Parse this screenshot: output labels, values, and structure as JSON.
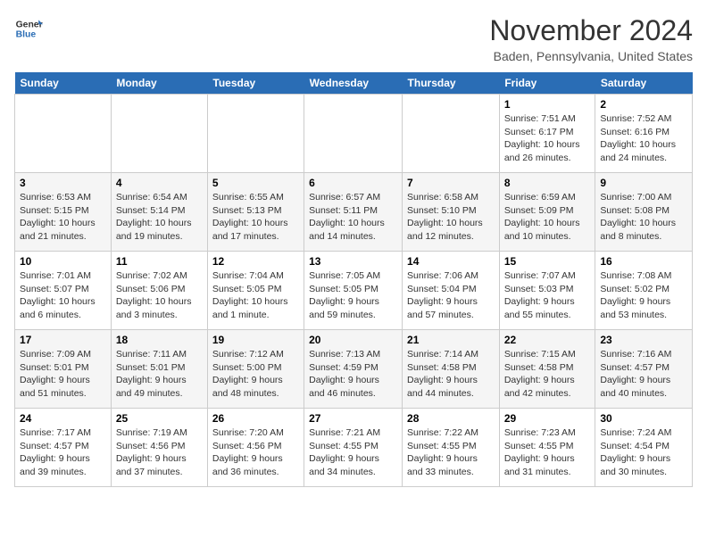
{
  "header": {
    "logo_line1": "General",
    "logo_line2": "Blue",
    "month_title": "November 2024",
    "location": "Baden, Pennsylvania, United States"
  },
  "weekdays": [
    "Sunday",
    "Monday",
    "Tuesday",
    "Wednesday",
    "Thursday",
    "Friday",
    "Saturday"
  ],
  "weeks": [
    [
      {
        "day": "",
        "info": ""
      },
      {
        "day": "",
        "info": ""
      },
      {
        "day": "",
        "info": ""
      },
      {
        "day": "",
        "info": ""
      },
      {
        "day": "",
        "info": ""
      },
      {
        "day": "1",
        "info": "Sunrise: 7:51 AM\nSunset: 6:17 PM\nDaylight: 10 hours\nand 26 minutes."
      },
      {
        "day": "2",
        "info": "Sunrise: 7:52 AM\nSunset: 6:16 PM\nDaylight: 10 hours\nand 24 minutes."
      }
    ],
    [
      {
        "day": "3",
        "info": "Sunrise: 6:53 AM\nSunset: 5:15 PM\nDaylight: 10 hours\nand 21 minutes."
      },
      {
        "day": "4",
        "info": "Sunrise: 6:54 AM\nSunset: 5:14 PM\nDaylight: 10 hours\nand 19 minutes."
      },
      {
        "day": "5",
        "info": "Sunrise: 6:55 AM\nSunset: 5:13 PM\nDaylight: 10 hours\nand 17 minutes."
      },
      {
        "day": "6",
        "info": "Sunrise: 6:57 AM\nSunset: 5:11 PM\nDaylight: 10 hours\nand 14 minutes."
      },
      {
        "day": "7",
        "info": "Sunrise: 6:58 AM\nSunset: 5:10 PM\nDaylight: 10 hours\nand 12 minutes."
      },
      {
        "day": "8",
        "info": "Sunrise: 6:59 AM\nSunset: 5:09 PM\nDaylight: 10 hours\nand 10 minutes."
      },
      {
        "day": "9",
        "info": "Sunrise: 7:00 AM\nSunset: 5:08 PM\nDaylight: 10 hours\nand 8 minutes."
      }
    ],
    [
      {
        "day": "10",
        "info": "Sunrise: 7:01 AM\nSunset: 5:07 PM\nDaylight: 10 hours\nand 6 minutes."
      },
      {
        "day": "11",
        "info": "Sunrise: 7:02 AM\nSunset: 5:06 PM\nDaylight: 10 hours\nand 3 minutes."
      },
      {
        "day": "12",
        "info": "Sunrise: 7:04 AM\nSunset: 5:05 PM\nDaylight: 10 hours\nand 1 minute."
      },
      {
        "day": "13",
        "info": "Sunrise: 7:05 AM\nSunset: 5:05 PM\nDaylight: 9 hours\nand 59 minutes."
      },
      {
        "day": "14",
        "info": "Sunrise: 7:06 AM\nSunset: 5:04 PM\nDaylight: 9 hours\nand 57 minutes."
      },
      {
        "day": "15",
        "info": "Sunrise: 7:07 AM\nSunset: 5:03 PM\nDaylight: 9 hours\nand 55 minutes."
      },
      {
        "day": "16",
        "info": "Sunrise: 7:08 AM\nSunset: 5:02 PM\nDaylight: 9 hours\nand 53 minutes."
      }
    ],
    [
      {
        "day": "17",
        "info": "Sunrise: 7:09 AM\nSunset: 5:01 PM\nDaylight: 9 hours\nand 51 minutes."
      },
      {
        "day": "18",
        "info": "Sunrise: 7:11 AM\nSunset: 5:01 PM\nDaylight: 9 hours\nand 49 minutes."
      },
      {
        "day": "19",
        "info": "Sunrise: 7:12 AM\nSunset: 5:00 PM\nDaylight: 9 hours\nand 48 minutes."
      },
      {
        "day": "20",
        "info": "Sunrise: 7:13 AM\nSunset: 4:59 PM\nDaylight: 9 hours\nand 46 minutes."
      },
      {
        "day": "21",
        "info": "Sunrise: 7:14 AM\nSunset: 4:58 PM\nDaylight: 9 hours\nand 44 minutes."
      },
      {
        "day": "22",
        "info": "Sunrise: 7:15 AM\nSunset: 4:58 PM\nDaylight: 9 hours\nand 42 minutes."
      },
      {
        "day": "23",
        "info": "Sunrise: 7:16 AM\nSunset: 4:57 PM\nDaylight: 9 hours\nand 40 minutes."
      }
    ],
    [
      {
        "day": "24",
        "info": "Sunrise: 7:17 AM\nSunset: 4:57 PM\nDaylight: 9 hours\nand 39 minutes."
      },
      {
        "day": "25",
        "info": "Sunrise: 7:19 AM\nSunset: 4:56 PM\nDaylight: 9 hours\nand 37 minutes."
      },
      {
        "day": "26",
        "info": "Sunrise: 7:20 AM\nSunset: 4:56 PM\nDaylight: 9 hours\nand 36 minutes."
      },
      {
        "day": "27",
        "info": "Sunrise: 7:21 AM\nSunset: 4:55 PM\nDaylight: 9 hours\nand 34 minutes."
      },
      {
        "day": "28",
        "info": "Sunrise: 7:22 AM\nSunset: 4:55 PM\nDaylight: 9 hours\nand 33 minutes."
      },
      {
        "day": "29",
        "info": "Sunrise: 7:23 AM\nSunset: 4:55 PM\nDaylight: 9 hours\nand 31 minutes."
      },
      {
        "day": "30",
        "info": "Sunrise: 7:24 AM\nSunset: 4:54 PM\nDaylight: 9 hours\nand 30 minutes."
      }
    ]
  ]
}
